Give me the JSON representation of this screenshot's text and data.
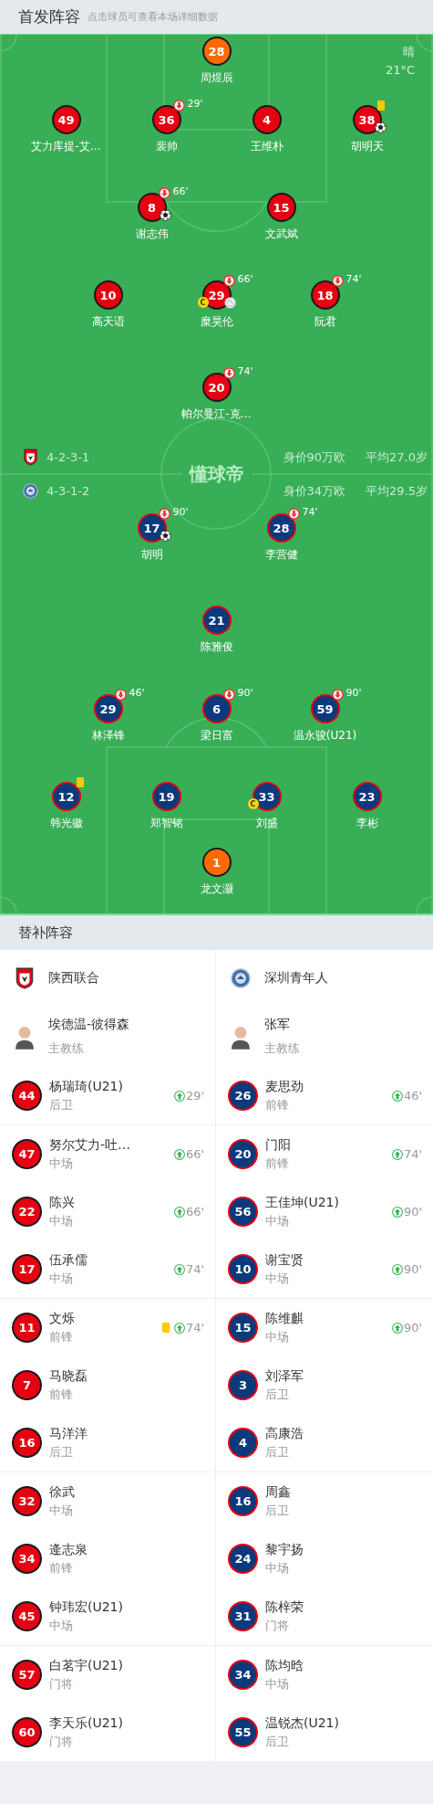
{
  "header": {
    "title": "首发阵容",
    "hint": "点击球员可查看本场详细数据"
  },
  "pitch": {
    "weather": "晴",
    "temperature": "21°C",
    "pitch_logo": "懂球帝"
  },
  "teams": [
    {
      "name": "陕西联合",
      "kind": "shield",
      "color": "#e60012",
      "formation": "4-2-3-1",
      "value": "身价90万欧",
      "avg_age": "平均27.0岁",
      "coach": "埃德温-彼得森",
      "coach_role": "主教练"
    },
    {
      "name": "深圳青年人",
      "kind": "roundel",
      "color": "#0b3a7c",
      "formation": "4-3-1-2",
      "value": "身价34万欧",
      "avg_age": "平均29.5岁",
      "coach": "张军",
      "coach_role": "主教练"
    }
  ],
  "lineups": [
    [
      [
        {
          "number": "28",
          "name": "周煜辰",
          "kind": "goalkeeper",
          "yellow_card": false,
          "goal": false,
          "assist": false
        }
      ],
      [
        {
          "number": "49",
          "name": "艾力库提-艾…",
          "kind": "outfield",
          "yellow_card": false,
          "goal": false,
          "assist": false
        },
        {
          "number": "36",
          "name": "裴帅",
          "kind": "outfield",
          "sub_off": "29'",
          "yellow_card": false,
          "goal": false,
          "assist": false
        },
        {
          "number": "4",
          "name": "王维朴",
          "kind": "outfield",
          "yellow_card": false,
          "goal": false,
          "assist": false
        },
        {
          "number": "38",
          "name": "胡明天",
          "kind": "outfield",
          "yellow_card": true,
          "goal": true,
          "assist": false
        }
      ],
      [
        {
          "number": "8",
          "name": "谢志伟",
          "kind": "outfield",
          "sub_off": "66'",
          "yellow_card": false,
          "goal": true,
          "assist": false
        },
        {
          "number": "15",
          "name": "文武斌",
          "kind": "outfield",
          "yellow_card": false,
          "goal": false,
          "assist": false
        }
      ],
      [
        {
          "number": "10",
          "name": "高天语",
          "kind": "outfield",
          "yellow_card": false,
          "goal": false,
          "assist": false
        },
        {
          "number": "29",
          "name": "糜昊伦",
          "kind": "outfield",
          "sub_off": "66'",
          "captain": "C",
          "yellow_card": false,
          "goal": false,
          "assist": true
        },
        {
          "number": "18",
          "name": "阮君",
          "kind": "outfield",
          "sub_off": "74'",
          "yellow_card": false,
          "goal": false,
          "assist": false
        }
      ],
      [
        {
          "number": "20",
          "name": "帕尔曼江-克…",
          "kind": "outfield",
          "sub_off": "74'",
          "yellow_card": false,
          "goal": false,
          "assist": false
        }
      ]
    ],
    [
      [
        {
          "number": "17",
          "name": "胡明",
          "kind": "outfield",
          "sub_off": "90'",
          "yellow_card": false,
          "goal": true,
          "assist": false
        },
        {
          "number": "28",
          "name": "李营健",
          "kind": "outfield",
          "sub_off": "74'",
          "yellow_card": false,
          "goal": false,
          "assist": false
        }
      ],
      [
        {
          "number": "21",
          "name": "陈雅俊",
          "kind": "outfield",
          "yellow_card": false,
          "goal": false,
          "assist": false
        }
      ],
      [
        {
          "number": "29",
          "name": "林泽锋",
          "kind": "outfield",
          "sub_off": "46'",
          "yellow_card": false,
          "goal": false,
          "assist": false
        },
        {
          "number": "6",
          "name": "梁日富",
          "kind": "outfield",
          "sub_off": "90'",
          "yellow_card": false,
          "goal": false,
          "assist": false
        },
        {
          "number": "59",
          "name": "温永骏(U21)",
          "kind": "outfield",
          "sub_off": "90'",
          "yellow_card": false,
          "goal": false,
          "assist": false
        }
      ],
      [
        {
          "number": "12",
          "name": "韩光徽",
          "kind": "outfield",
          "yellow_card": true,
          "goal": false,
          "assist": false
        },
        {
          "number": "19",
          "name": "郑智铭",
          "kind": "outfield",
          "yellow_card": false,
          "goal": false,
          "assist": false
        },
        {
          "number": "33",
          "name": "刘盛",
          "kind": "outfield",
          "captain": "C",
          "yellow_card": false,
          "goal": false,
          "assist": false
        },
        {
          "number": "23",
          "name": "李彬",
          "kind": "outfield",
          "yellow_card": false,
          "goal": false,
          "assist": false
        }
      ],
      [
        {
          "number": "1",
          "name": "龙文灏",
          "kind": "goalkeeper",
          "yellow_card": false,
          "goal": false,
          "assist": false
        }
      ]
    ]
  ],
  "substitutes": {
    "title": "替补阵容",
    "groups": [
      [
        [
          {
            "number": "44",
            "name": "杨瑞琦(U21)",
            "position": "后卫",
            "sub_on": "29'",
            "yellow_card": false
          },
          {
            "number": "26",
            "name": "麦思劲",
            "position": "前锋",
            "sub_on": "46'",
            "yellow_card": false
          }
        ]
      ],
      [
        [
          {
            "number": "47",
            "name": "努尔艾力-吐…",
            "position": "中场",
            "sub_on": "66'",
            "yellow_card": false
          },
          {
            "number": "20",
            "name": "门阳",
            "position": "前锋",
            "sub_on": "74'",
            "yellow_card": false
          }
        ],
        [
          {
            "number": "22",
            "name": "陈兴",
            "position": "中场",
            "sub_on": "66'",
            "yellow_card": false
          },
          {
            "number": "56",
            "name": "王佳坤(U21)",
            "position": "中场",
            "sub_on": "90'",
            "yellow_card": false
          }
        ],
        [
          {
            "number": "17",
            "name": "伍承儒",
            "position": "中场",
            "sub_on": "74'",
            "yellow_card": false
          },
          {
            "number": "10",
            "name": "谢宝贤",
            "position": "中场",
            "sub_on": "90'",
            "yellow_card": false
          }
        ]
      ],
      [
        [
          {
            "number": "11",
            "name": "文烁",
            "position": "前锋",
            "sub_on": "74'",
            "yellow_card": true
          },
          {
            "number": "15",
            "name": "陈维麒",
            "position": "中场",
            "sub_on": "90'",
            "yellow_card": false
          }
        ],
        [
          {
            "number": "7",
            "name": "马晓磊",
            "position": "前锋",
            "yellow_card": false
          },
          {
            "number": "3",
            "name": "刘泽军",
            "position": "后卫",
            "yellow_card": false
          }
        ],
        [
          {
            "number": "16",
            "name": "马洋洋",
            "position": "后卫",
            "yellow_card": false
          },
          {
            "number": "4",
            "name": "高康浩",
            "position": "后卫",
            "yellow_card": false
          }
        ]
      ],
      [
        [
          {
            "number": "32",
            "name": "徐武",
            "position": "中场",
            "yellow_card": false
          },
          {
            "number": "16",
            "name": "周鑫",
            "position": "后卫",
            "yellow_card": false
          }
        ],
        [
          {
            "number": "34",
            "name": "逄志泉",
            "position": "前锋",
            "yellow_card": false
          },
          {
            "number": "24",
            "name": "黎宇扬",
            "position": "中场",
            "yellow_card": false
          }
        ],
        [
          {
            "number": "45",
            "name": "钟玮宏(U21)",
            "position": "中场",
            "yellow_card": false
          },
          {
            "number": "31",
            "name": "陈梓荣",
            "position": "门将",
            "yellow_card": false
          }
        ]
      ],
      [
        [
          {
            "number": "57",
            "name": "白茗宇(U21)",
            "position": "门将",
            "yellow_card": false
          },
          {
            "number": "34",
            "name": "陈均晗",
            "position": "中场",
            "yellow_card": false
          }
        ],
        [
          {
            "number": "60",
            "name": "李天乐(U21)",
            "position": "门将",
            "yellow_card": false
          },
          {
            "number": "55",
            "name": "温锐杰(U21)",
            "position": "后卫",
            "yellow_card": false
          }
        ]
      ]
    ]
  }
}
